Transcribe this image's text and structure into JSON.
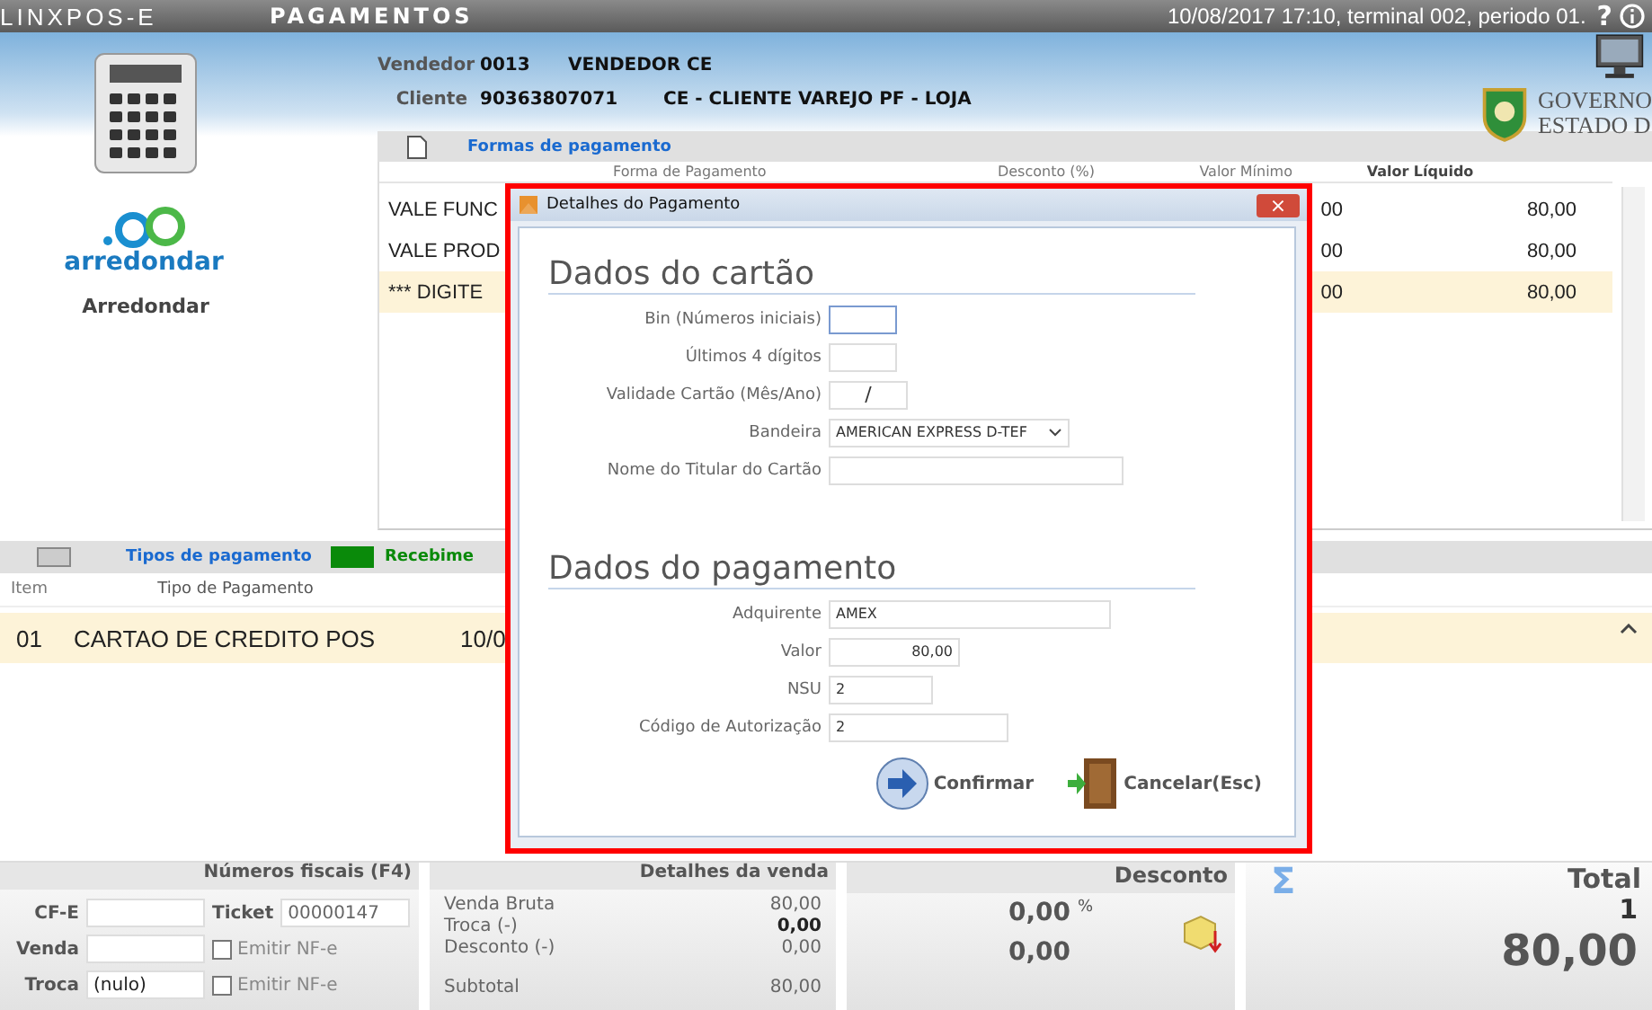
{
  "app_bar": {
    "product": "LINXPOS-E",
    "screen": "PAGAMENTOS",
    "status": "10/08/2017 17:10, terminal 002, periodo 01.",
    "help": "?"
  },
  "sidebar": {
    "logo_text": "arredondar",
    "label": "Arredondar"
  },
  "sale_info": [
    {
      "label": "Vendedor",
      "code": "0013",
      "name": "VENDEDOR CE"
    },
    {
      "label": "Cliente",
      "code": "90363807071",
      "name": "CE - CLIENTE VAREJO PF - LOJA"
    }
  ],
  "government": {
    "line_1": "GOVERNO",
    "line_2": "ESTADO D"
  },
  "payment_forms": {
    "title": "Formas de pagamento",
    "columns": [
      "Forma de Pagamento",
      "Desconto (%)",
      "Valor Mínimo",
      "Valor Líquido"
    ],
    "rows": [
      {
        "column_1": "VALE FUNC",
        "column_3": "00",
        "column_4": "80,00",
        "selected": false
      },
      {
        "column_1": "VALE PROD",
        "column_3": "00",
        "column_4": "80,00",
        "selected": false
      },
      {
        "column_1": "*** DIGITE",
        "column_3": "00",
        "column_4": "80,00",
        "selected": true
      }
    ]
  },
  "payment_types": {
    "title": "Tipos de pagamento",
    "received_label": "Recebime",
    "columns": [
      "Item",
      "Tipo de Pagamento"
    ],
    "rows": [
      {
        "item": "01",
        "type": "CARTAO DE CREDITO POS",
        "date": "10/0",
        "selected": true
      }
    ]
  },
  "dialog": {
    "title": "Detalhes do Pagamento",
    "close": "×",
    "sections": [
      {
        "title": "Dados do cartão",
        "fields": [
          {
            "kind": "text",
            "label": "Bin (Números iniciais)",
            "focused": true
          },
          {
            "kind": "text",
            "label": "Últimos 4 dígitos",
            "focused": false
          },
          {
            "kind": "date",
            "label": "Validade Cartão (Mês/Ano)",
            "value": "/",
            "focused": false
          },
          {
            "kind": "select",
            "label": "Bandeira",
            "value": "AMERICAN EXPRESS D-TEF",
            "focused": false
          },
          {
            "kind": "text",
            "label": "Nome do Titular do Cartão",
            "focused": false
          }
        ]
      },
      {
        "title": "Dados do pagamento",
        "fields": [
          {
            "kind": "text",
            "label": "Adquirente",
            "value": "AMEX",
            "focused": false
          },
          {
            "kind": "amount",
            "label": "Valor",
            "value": "80,00",
            "focused": false
          },
          {
            "kind": "text",
            "label": "NSU",
            "value": "2",
            "focused": false
          },
          {
            "kind": "text",
            "label": "Código de Autorização",
            "value": "2",
            "focused": false
          }
        ]
      }
    ],
    "buttons": [
      {
        "kind": "confirm",
        "label": "Confirmar"
      },
      {
        "kind": "cancel",
        "label": "Cancelar(Esc)"
      }
    ]
  },
  "fiscal": {
    "title": "Números fiscais (F4)",
    "rows": [
      {
        "label": "CF-E",
        "side": {
          "kind": "field",
          "label": "Ticket",
          "value": "00000147"
        }
      },
      {
        "label": "Venda",
        "side": {
          "kind": "checkbox",
          "label": "Emitir NF-e",
          "checked": false
        }
      },
      {
        "label": "Troca",
        "value": "(nulo)",
        "side": {
          "kind": "checkbox",
          "label": "Emitir NF-e",
          "checked": false
        }
      }
    ]
  },
  "sale_details": {
    "title": "Detalhes da venda",
    "lines": [
      {
        "kind": "line",
        "label": "Venda Bruta",
        "value": "80,00",
        "highlighted": false
      },
      {
        "kind": "line",
        "label": "Troca (-)",
        "value": "0,00",
        "highlighted": true
      },
      {
        "kind": "line",
        "label": "Desconto (-)",
        "value": "0,00",
        "highlighted": false
      },
      {
        "kind": "subtotal",
        "label": "Subtotal",
        "value": "80,00",
        "highlighted": false
      }
    ]
  },
  "discount": {
    "title": "Desconto",
    "percent": "0,00",
    "percent_sign": "%",
    "amount": "0,00"
  },
  "total": {
    "symbol": "Σ",
    "title": "Total",
    "quantity": "1",
    "amount": "80,00"
  }
}
